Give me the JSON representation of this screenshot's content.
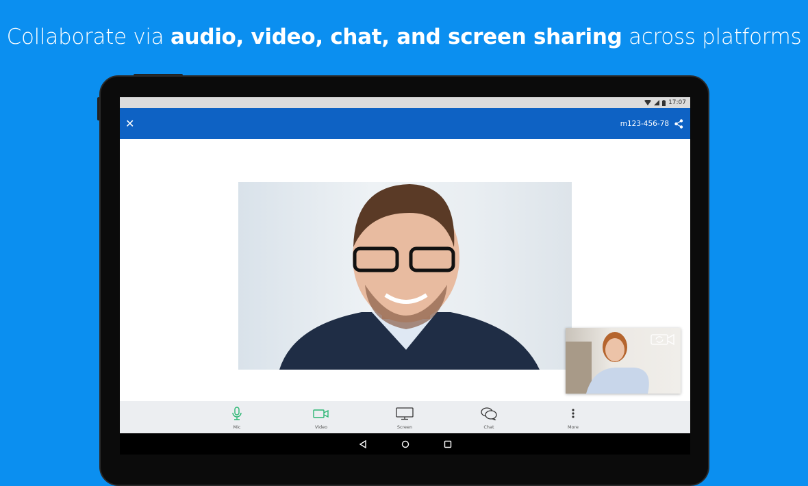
{
  "headline": {
    "pre": "Collaborate via ",
    "bold": "audio, video, chat, and screen sharing",
    "post": " across platforms"
  },
  "status_bar": {
    "time": "17:07"
  },
  "app_bar": {
    "meeting_id": "m123-456-78"
  },
  "toolbar": {
    "items": [
      {
        "label": "Mic",
        "icon": "mic-icon",
        "color": "#2bb673"
      },
      {
        "label": "Video",
        "icon": "video-camera-icon",
        "color": "#2bb673"
      },
      {
        "label": "Screen",
        "icon": "monitor-icon",
        "color": "#333333"
      },
      {
        "label": "Chat",
        "icon": "chat-bubbles-icon",
        "color": "#333333"
      },
      {
        "label": "More",
        "icon": "more-vertical-icon",
        "color": "#333333"
      }
    ]
  },
  "colors": {
    "background": "#0b8ff0",
    "app_bar": "#0e62c4",
    "accent_green": "#2bb673"
  }
}
